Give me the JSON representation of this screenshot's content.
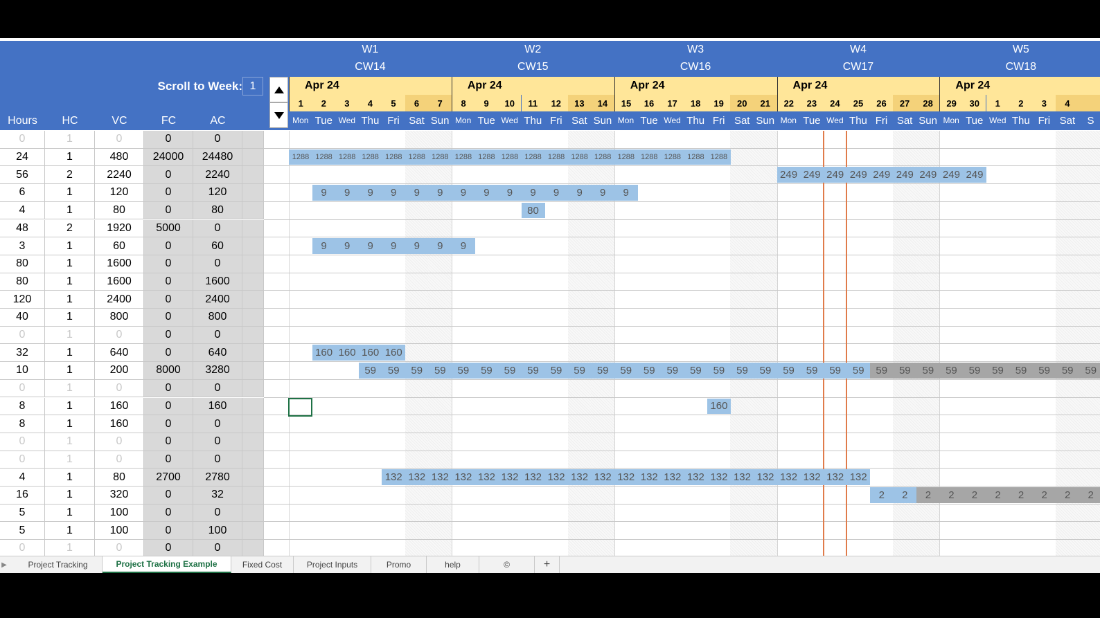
{
  "weeks": [
    {
      "w": "W1",
      "cw": "CW14"
    },
    {
      "w": "W2",
      "cw": "CW15"
    },
    {
      "w": "W3",
      "cw": "CW16"
    },
    {
      "w": "W4",
      "cw": "CW17"
    },
    {
      "w": "W5",
      "cw": "CW18"
    }
  ],
  "scroll": {
    "label": "Scroll to Week:",
    "value": "1"
  },
  "month_label": "Apr 24",
  "days": [
    "1",
    "2",
    "3",
    "4",
    "5",
    "6",
    "7",
    "8",
    "9",
    "10",
    "11",
    "12",
    "13",
    "14",
    "15",
    "16",
    "17",
    "18",
    "19",
    "20",
    "21",
    "22",
    "23",
    "24",
    "25",
    "26",
    "27",
    "28",
    "29",
    "30",
    "1",
    "2",
    "3",
    "4",
    ""
  ],
  "day_names": [
    "Mon",
    "Tue",
    "Wed",
    "Thu",
    "Fri",
    "Sat",
    "Sun",
    "Mon",
    "Tue",
    "Wed",
    "Thu",
    "Fri",
    "Sat",
    "Sun",
    "Mon",
    "Tue",
    "Wed",
    "Thu",
    "Fri",
    "Sat",
    "Sun",
    "Mon",
    "Tue",
    "Wed",
    "Thu",
    "Fri",
    "Sat",
    "Sun",
    "Mon",
    "Tue",
    "Wed",
    "Thu",
    "Fri",
    "Sat",
    "S"
  ],
  "columns": [
    "Hours",
    "HC",
    "VC",
    "FC",
    "AC"
  ],
  "rows": [
    [
      "0",
      "1",
      "0",
      "0",
      "0"
    ],
    [
      "24",
      "1",
      "480",
      "24000",
      "24480"
    ],
    [
      "56",
      "2",
      "2240",
      "0",
      "2240"
    ],
    [
      "6",
      "1",
      "120",
      "0",
      "120"
    ],
    [
      "4",
      "1",
      "80",
      "0",
      "80"
    ],
    [
      "48",
      "2",
      "1920",
      "5000",
      "0"
    ],
    [
      "3",
      "1",
      "60",
      "0",
      "60"
    ],
    [
      "80",
      "1",
      "1600",
      "0",
      "0"
    ],
    [
      "80",
      "1",
      "1600",
      "0",
      "1600"
    ],
    [
      "120",
      "1",
      "2400",
      "0",
      "2400"
    ],
    [
      "40",
      "1",
      "800",
      "0",
      "800"
    ],
    [
      "0",
      "1",
      "0",
      "0",
      "0"
    ],
    [
      "32",
      "1",
      "640",
      "0",
      "640"
    ],
    [
      "10",
      "1",
      "200",
      "8000",
      "3280"
    ],
    [
      "0",
      "1",
      "0",
      "0",
      "0"
    ],
    [
      "8",
      "1",
      "160",
      "0",
      "160"
    ],
    [
      "8",
      "1",
      "160",
      "0",
      "0"
    ],
    [
      "0",
      "1",
      "0",
      "0",
      "0"
    ],
    [
      "0",
      "1",
      "0",
      "0",
      "0"
    ],
    [
      "4",
      "1",
      "80",
      "2700",
      "2780"
    ],
    [
      "16",
      "1",
      "320",
      "0",
      "32"
    ],
    [
      "5",
      "1",
      "100",
      "0",
      "0"
    ],
    [
      "5",
      "1",
      "100",
      "0",
      "100"
    ],
    [
      "0",
      "1",
      "0",
      "0",
      "0"
    ]
  ],
  "faded_rows": [
    0,
    11,
    14,
    17,
    18,
    23
  ],
  "bars": [
    {
      "row": 1,
      "start": 0,
      "end": 19,
      "value": "1288",
      "small": true
    },
    {
      "row": 2,
      "start": 21,
      "end": 30,
      "value": "249"
    },
    {
      "row": 3,
      "start": 1,
      "end": 15,
      "value": "9"
    },
    {
      "row": 4,
      "start": 10,
      "end": 11,
      "value": "80"
    },
    {
      "row": 6,
      "start": 1,
      "end": 8,
      "value": "9"
    },
    {
      "row": 12,
      "start": 1,
      "end": 5,
      "value": "160"
    },
    {
      "row": 13,
      "start": 3,
      "end": 25,
      "value": "59"
    },
    {
      "row": 13,
      "start": 25,
      "end": 35,
      "value": "59",
      "gray": true
    },
    {
      "row": 15,
      "start": 18,
      "end": 19,
      "value": "160"
    },
    {
      "row": 19,
      "start": 4,
      "end": 25,
      "value": "132"
    },
    {
      "row": 20,
      "start": 25,
      "end": 27,
      "value": "2"
    },
    {
      "row": 20,
      "start": 27,
      "end": 35,
      "value": "2",
      "gray": true
    }
  ],
  "tabs": [
    {
      "label": "Project Tracking",
      "active": false
    },
    {
      "label": "Project Tracking Example",
      "active": true
    },
    {
      "label": "Fixed Cost",
      "active": false
    },
    {
      "label": "Project Inputs",
      "active": false
    },
    {
      "label": "Promo",
      "active": false
    },
    {
      "label": "help",
      "active": false
    },
    {
      "label": "©",
      "active": false
    }
  ],
  "add_sheet_label": "+",
  "icons": [
    "triangle-up-icon",
    "triangle-down-icon",
    "sheet-scroll-left-icon",
    "add-sheet-icon"
  ]
}
